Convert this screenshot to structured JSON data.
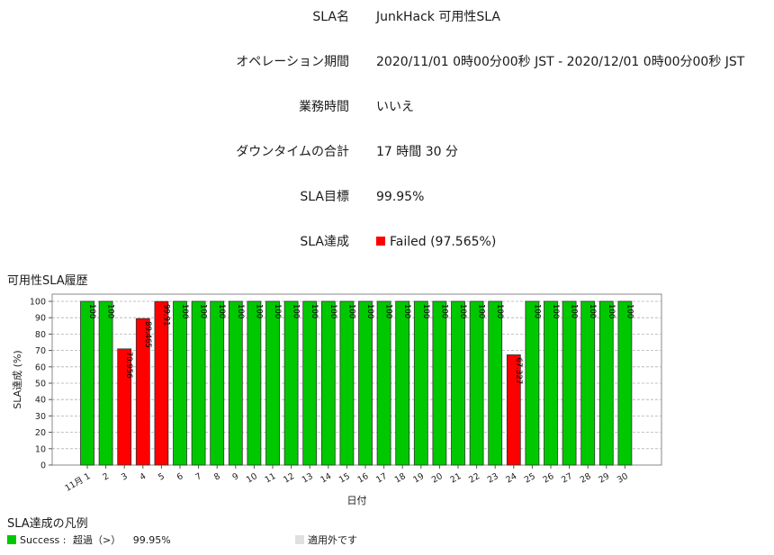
{
  "info": [
    {
      "label": "SLA名",
      "value": "JunkHack 可用性SLA"
    },
    {
      "label": "オペレーション期間",
      "value": "2020/11/01 0時00分00秒 JST - 2020/12/01 0時00分00秒 JST"
    },
    {
      "label": "業務時間",
      "value": "いいえ"
    },
    {
      "label": "ダウンタイムの合計",
      "value": "17 時間 30 分"
    },
    {
      "label": "SLA目標",
      "value": "99.95%"
    },
    {
      "label": "SLA達成",
      "value": "Failed (97.565%)",
      "status_color": "#ff0000"
    }
  ],
  "history_title": "可用性SLA履歴",
  "chart_data": {
    "type": "bar",
    "title": "",
    "xlabel": "日付",
    "ylabel": "SLA達成 (%)",
    "ylim": [
      0,
      100
    ],
    "yticks": [
      0,
      10,
      20,
      30,
      40,
      50,
      60,
      70,
      80,
      90,
      100
    ],
    "grid": true,
    "categories": [
      "11月 1",
      "2",
      "3",
      "4",
      "5",
      "6",
      "7",
      "8",
      "9",
      "10",
      "11",
      "12",
      "13",
      "14",
      "15",
      "16",
      "17",
      "18",
      "19",
      "20",
      "21",
      "22",
      "23",
      "24",
      "25",
      "26",
      "27",
      "28",
      "29",
      "30"
    ],
    "values": [
      100,
      100,
      70.956,
      89.465,
      99.91,
      100,
      100,
      100,
      100,
      100,
      100,
      100,
      100,
      100,
      100,
      100,
      100,
      100,
      100,
      100,
      100,
      100,
      100,
      67.327,
      100,
      100,
      100,
      100,
      100,
      100
    ],
    "value_labels": [
      "100",
      "100",
      "70.956",
      "89.465",
      "99.91",
      "100",
      "100",
      "100",
      "100",
      "100",
      "100",
      "100",
      "100",
      "100",
      "100",
      "100",
      "100",
      "100",
      "100",
      "100",
      "100",
      "100",
      "100",
      "67.327",
      "100",
      "100",
      "100",
      "100",
      "100",
      "100"
    ],
    "success_color": "#00c800",
    "fail_color": "#ff0000",
    "target": 99.95
  },
  "legend": {
    "title": "SLA達成の凡例",
    "success_name": "Success :",
    "success_rule": "超過（>）",
    "success_value": "99.95%",
    "success_color": "#00c800",
    "na_label": "適用外です",
    "na_color": "#e0e0e0"
  }
}
